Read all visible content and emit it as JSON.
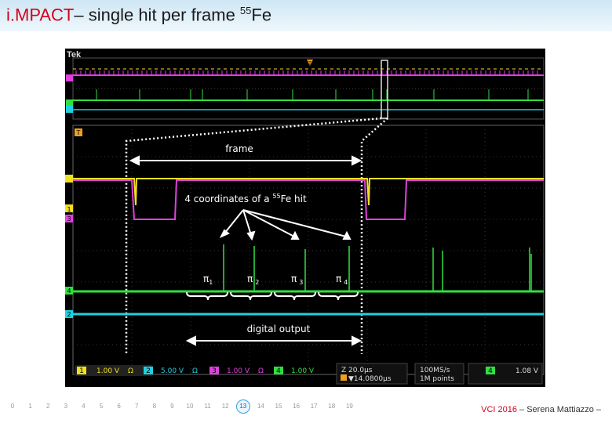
{
  "title": {
    "prefix": "i.MPACT",
    "rest": "– single hit per frame ",
    "sup": "55",
    "element": "Fe"
  },
  "scope": {
    "brand": "Tek",
    "labels": {
      "frame": "frame",
      "coords_prefix": "4 coordinates of a ",
      "coords_sup": "55",
      "coords_suffix": "Fe hit",
      "digital": "digital output"
    },
    "pis": [
      "π",
      "π",
      "π",
      "π"
    ],
    "pi_subs": [
      "1",
      "2",
      "3",
      "4"
    ],
    "ch_markers": {
      "t_top": "T",
      "t_mid": "T",
      "ch1": "1",
      "ch3": "3",
      "ch4": "4",
      "ch2": "2"
    },
    "status": {
      "ch1": "1",
      "ch1_val": "1.00 V",
      "ch1_unit": "Ω",
      "ch2": "2",
      "ch2_val": "5.00 V",
      "ch2_unit": "Ω",
      "ch3": "3",
      "ch3_val": "1.00 V",
      "ch3_unit": "Ω",
      "ch4": "4",
      "ch4_val": "1.00 V",
      "z": "Z 20.0µs",
      "t": "▼14.0800µs",
      "rate": "100MS/s",
      "points": "1M points",
      "trig_ch": "4",
      "trig_val": "1.08 V"
    }
  },
  "nav": [
    "0",
    "1",
    "2",
    "3",
    "4",
    "5",
    "6",
    "7",
    "8",
    "9",
    "10",
    "11",
    "12",
    "13",
    "14",
    "15",
    "16",
    "17",
    "18",
    "19"
  ],
  "nav_active": "13",
  "footer": {
    "vci": "VCI 2016",
    "rest": " – Serena Mattiazzo –"
  },
  "colors": {
    "ch1": "#f0e020",
    "ch2": "#20d0e0",
    "ch3": "#e040e0",
    "ch4": "#30e040",
    "accent": "#d6001c"
  }
}
